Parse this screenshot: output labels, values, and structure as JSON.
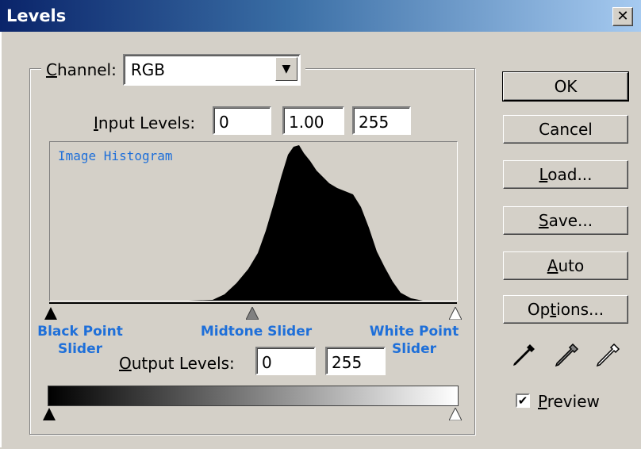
{
  "window": {
    "title": "Levels",
    "close_glyph": "✕"
  },
  "channel": {
    "label": "Channel:",
    "value": "RGB"
  },
  "input_levels": {
    "label": "Input Levels:",
    "black": "0",
    "midtone": "1.00",
    "white": "255"
  },
  "histogram": {
    "label": "Image Histogram"
  },
  "annotations": {
    "black_point": "Black Point\nSlider",
    "midtone": "Midtone Slider",
    "white_point": "White Point\nSlider"
  },
  "output_levels": {
    "label": "Output Levels:",
    "black": "0",
    "white": "255"
  },
  "buttons": {
    "ok": "OK",
    "cancel": "Cancel",
    "load": "Load...",
    "save": "Save...",
    "auto": "Auto",
    "options": "Options..."
  },
  "preview": {
    "label": "Preview",
    "checked": true
  },
  "icons": [
    "black-eyedropper-icon",
    "gray-eyedropper-icon",
    "white-eyedropper-icon"
  ],
  "colors": {
    "title_start": "#0a246a",
    "title_end": "#a6caf0",
    "annotation": "#1e6fd9",
    "dialog_bg": "#d4d0c8"
  }
}
